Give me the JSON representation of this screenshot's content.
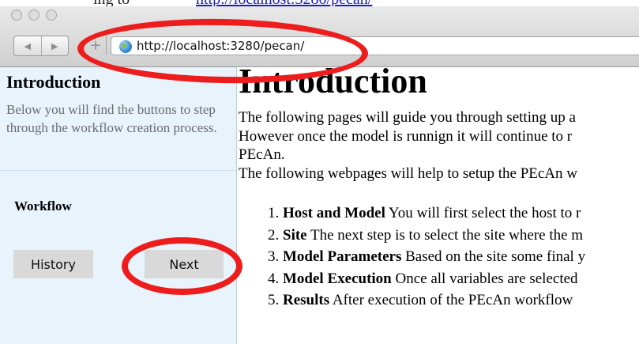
{
  "browser": {
    "url": "http://localhost:3280/pecan/",
    "back_glyph": "◀",
    "forward_glyph": "▶",
    "new_tab_glyph": "+"
  },
  "caption": {
    "text": "ing to",
    "link": "http://localhost:3280/pecan/"
  },
  "sidebar": {
    "title": "Introduction",
    "description": "Below you will find the buttons to step through the workflow creation process.",
    "workflow_label": "Workflow",
    "history_button": "History",
    "next_button": "Next"
  },
  "main": {
    "heading": "Introduction",
    "paragraph_lines": [
      "The following pages will guide you through setting up a",
      "However once the model is runnign it will continue to r",
      "PEcAn.",
      "The following webpages will help to setup the PEcAn w"
    ],
    "steps": [
      {
        "title": "Host and Model",
        "text": " You will first select the host to r"
      },
      {
        "title": "Site",
        "text": " The next step is to select the site where the m"
      },
      {
        "title": "Model Parameters",
        "text": " Based on the site some final y"
      },
      {
        "title": "Model Execution",
        "text": " Once all variables are selected"
      },
      {
        "title": "Results",
        "text": " After execution of the PEcAn workflow"
      }
    ]
  },
  "colors": {
    "annotation": "#ee1d1d",
    "sidebar_bg": "#e8f3fb",
    "button_bg": "#d9d9d9"
  },
  "icons": {
    "url_bar": "globe-icon"
  }
}
